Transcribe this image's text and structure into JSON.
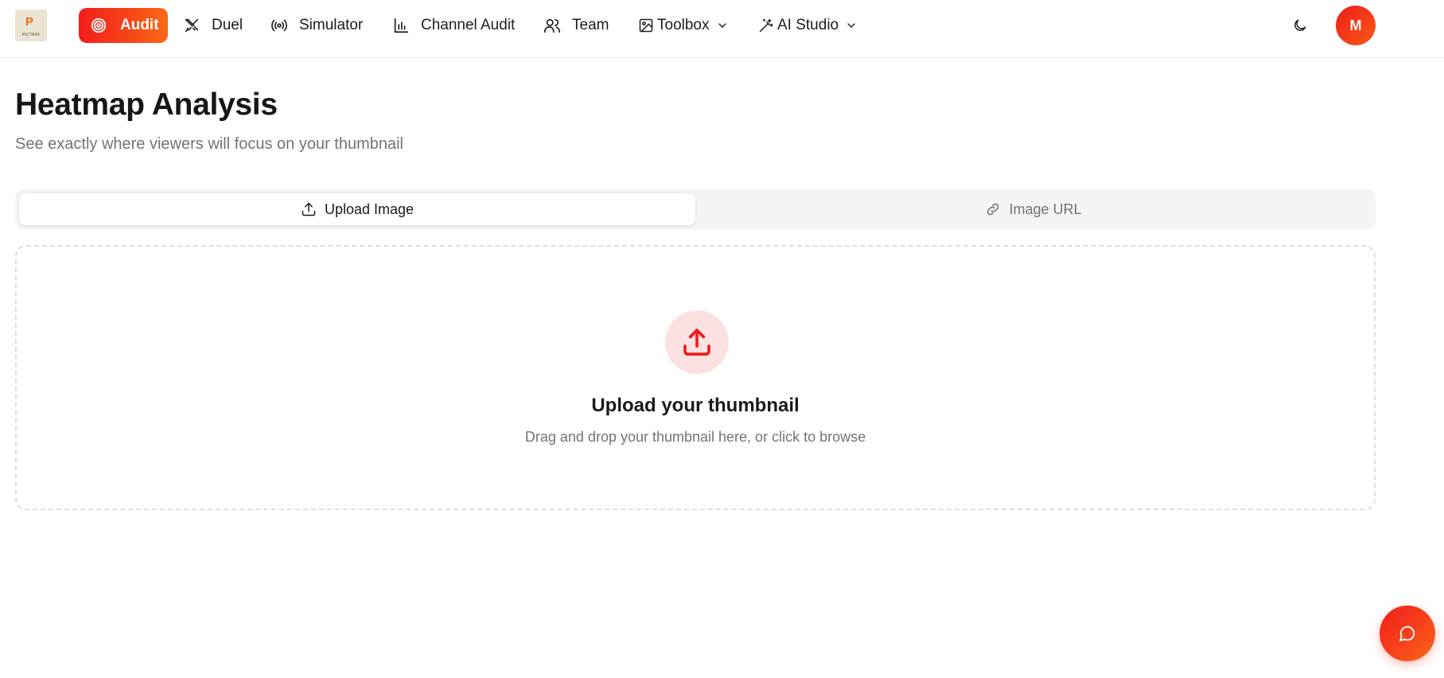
{
  "brand": {
    "logo_letter": "P",
    "logo_word": "PICTRAY"
  },
  "nav": {
    "items": [
      {
        "label": "Audit",
        "icon": "target-icon",
        "active": true
      },
      {
        "label": "Duel",
        "icon": "crossed-swords-icon"
      },
      {
        "label": "Simulator",
        "icon": "broadcast-icon"
      },
      {
        "label": "Channel Audit",
        "icon": "bar-chart-icon"
      },
      {
        "label": "Team",
        "icon": "users-icon"
      },
      {
        "label": "Toolbox",
        "icon": "image-icon",
        "dropdown": true
      },
      {
        "label": "AI Studio",
        "icon": "magic-wand-icon",
        "dropdown": true
      }
    ],
    "theme_toggle_icon": "moon-icon",
    "avatar_initial": "M"
  },
  "page": {
    "title": "Heatmap Analysis",
    "subtitle": "See exactly where viewers will focus on your thumbnail"
  },
  "tabs": [
    {
      "label": "Upload Image",
      "icon": "upload-icon",
      "selected": true
    },
    {
      "label": "Image URL",
      "icon": "link-icon",
      "selected": false
    }
  ],
  "dropzone": {
    "icon": "upload-icon",
    "title": "Upload your thumbnail",
    "hint": "Drag and drop your thumbnail here, or click to browse"
  },
  "chat": {
    "icon": "chat-bubble-icon"
  },
  "colors": {
    "accent": "#f21d1d",
    "accent_end": "#fa6a18",
    "upload_circle_bg": "#fde1e1",
    "muted_text": "#737373"
  }
}
